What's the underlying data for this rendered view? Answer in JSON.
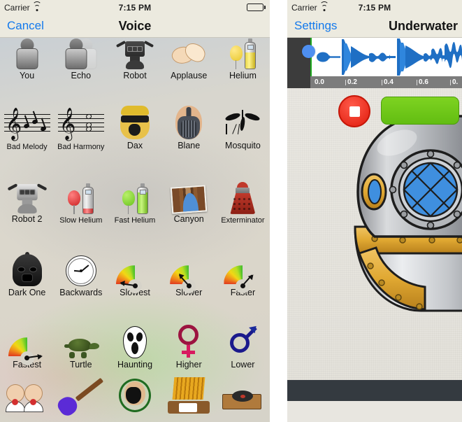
{
  "left_phone": {
    "status_bar": {
      "carrier": "Carrier",
      "wifi_icon": "wifi-icon",
      "time": "7:15 PM",
      "battery_icon": "battery-full-icon"
    },
    "nav": {
      "back_label": "Cancel",
      "title": "Voice"
    },
    "grid_rows": [
      [
        {
          "label": "You",
          "icon": "person-silhouette-icon"
        },
        {
          "label": "Echo",
          "icon": "person-echo-icon"
        },
        {
          "label": "Robot",
          "icon": "robot-icon"
        },
        {
          "label": "Applause",
          "icon": "clapping-hands-icon"
        },
        {
          "label": "Helium",
          "icon": "helium-balloon-tank-icon"
        }
      ],
      [
        {
          "label": "Bad Melody",
          "icon": "music-staff-melody-icon"
        },
        {
          "label": "Bad Harmony",
          "icon": "music-staff-harmony-icon"
        },
        {
          "label": "Dax",
          "icon": "dax-face-icon"
        },
        {
          "label": "Blane",
          "icon": "blane-mask-icon"
        },
        {
          "label": "Mosquito",
          "icon": "mosquito-icon"
        }
      ],
      [
        {
          "label": "Robot 2",
          "icon": "robot2-icon"
        },
        {
          "label": "Slow Helium",
          "icon": "red-balloon-tank-icon"
        },
        {
          "label": "Fast Helium",
          "icon": "green-balloon-tank-icon"
        },
        {
          "label": "Canyon",
          "icon": "canyon-photo-icon"
        },
        {
          "label": "Exterminator",
          "icon": "dalek-icon"
        }
      ],
      [
        {
          "label": "Dark One",
          "icon": "dark-helmet-icon"
        },
        {
          "label": "Backwards",
          "icon": "reverse-clock-icon"
        },
        {
          "label": "Slowest",
          "icon": "speed-gauge-slowest-icon"
        },
        {
          "label": "Slower",
          "icon": "speed-gauge-slower-icon"
        },
        {
          "label": "Faster",
          "icon": "speed-gauge-faster-icon"
        }
      ],
      [
        {
          "label": "Fastest",
          "icon": "speed-gauge-fastest-icon"
        },
        {
          "label": "Turtle",
          "icon": "turtle-icon"
        },
        {
          "label": "Haunting",
          "icon": "ghost-face-icon"
        },
        {
          "label": "Higher",
          "icon": "venus-symbol-icon"
        },
        {
          "label": "Lower",
          "icon": "mars-symbol-icon"
        }
      ],
      [
        {
          "label": "",
          "icon": "two-singers-icon"
        },
        {
          "label": "",
          "icon": "electric-guitar-icon"
        },
        {
          "label": "",
          "icon": "gas-mask-icon"
        },
        {
          "label": "",
          "icon": "pipe-organ-icon"
        },
        {
          "label": "",
          "icon": "gramophone-icon"
        }
      ]
    ]
  },
  "right_phone": {
    "status_bar": {
      "carrier": "Carrier",
      "wifi_icon": "wifi-icon",
      "time": "7:15 PM"
    },
    "nav": {
      "back_label": "Settings",
      "title": "Underwater"
    },
    "waveform": {
      "playhead_icon": "playhead-handle-icon",
      "ruler_ticks": [
        "0.0",
        "0.2",
        "0.4",
        "0.6",
        "0."
      ],
      "waveform_color": "#1f6fc4",
      "start_marker_color": "#1faa1f"
    },
    "effect_art": {
      "icon": "diving-helmet-icon",
      "label": "Underwater"
    },
    "toolbar": {
      "record_button": "record-button",
      "record_icon": "stop-square-icon",
      "action_button": "play-share-button",
      "record_color": "#e01b0c",
      "action_color": "#7ed321"
    }
  }
}
